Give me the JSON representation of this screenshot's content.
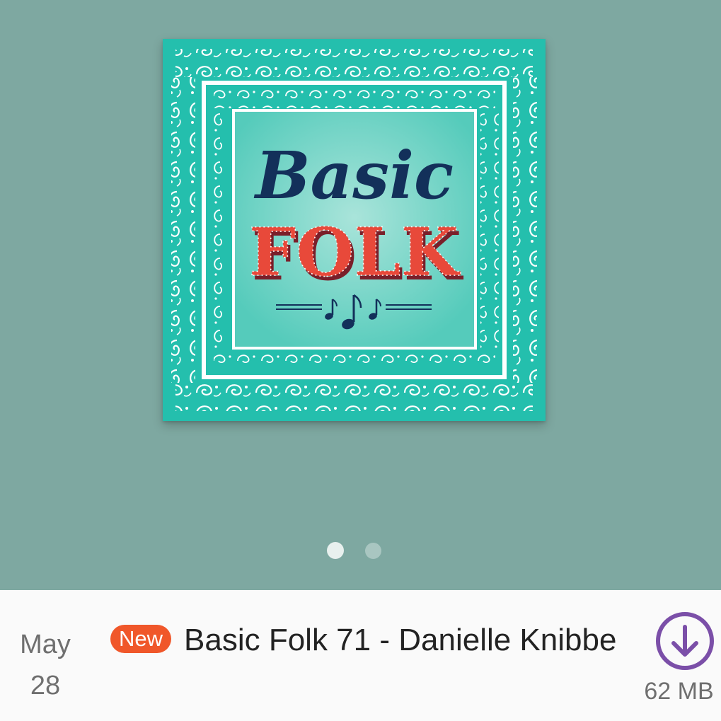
{
  "artwork": {
    "title_line1": "Basic",
    "title_line2": "FOLK",
    "background_color": "#24bfad",
    "title1_color": "#13305a",
    "title2_color": "#e8493a",
    "icon": "music-notes-icon"
  },
  "pager": {
    "total_pages": 2,
    "active_page": 1
  },
  "episode": {
    "date_month": "May",
    "date_day": "28",
    "badge": "New",
    "title": "Basic Folk 71 - Danielle Knibbe",
    "size": "62 MB",
    "download_icon": "download-icon",
    "accent_color": "#7b4fa8",
    "badge_color": "#f0572a"
  }
}
